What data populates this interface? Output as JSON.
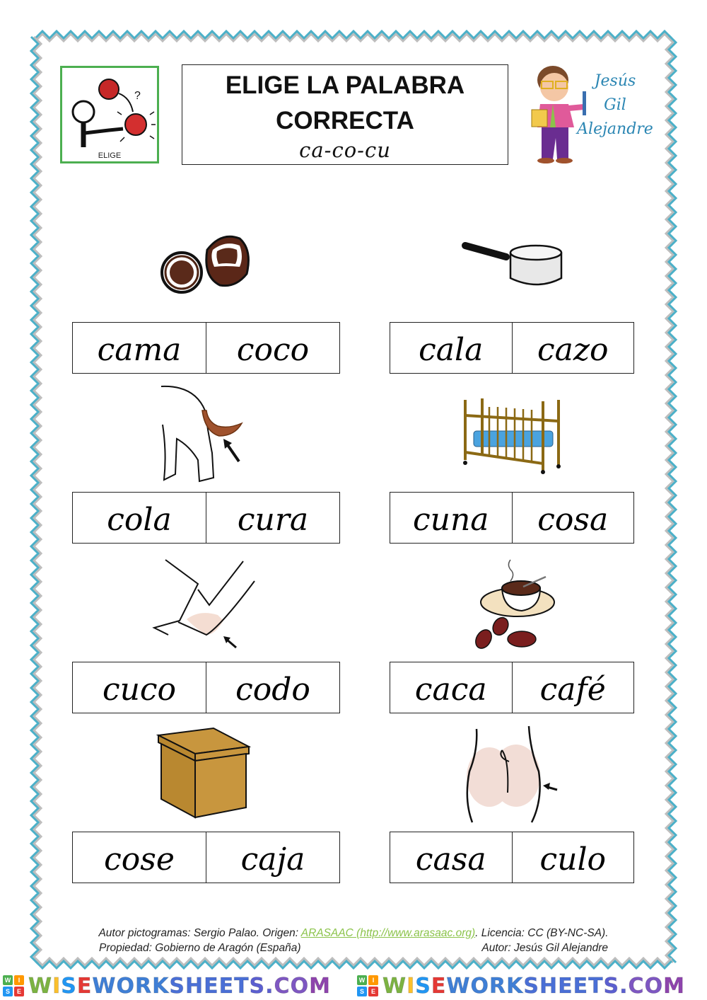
{
  "header": {
    "pictogram_label": "ELIGE",
    "title_line1": "ELIGE LA PALABRA",
    "title_line2": "CORRECTA",
    "syllables": "ca-co-cu",
    "author_first": "Jesús",
    "author_middle": "Gil",
    "author_last": "Alejandre"
  },
  "items": [
    {
      "picture": "coconut",
      "options": [
        "cama",
        "coco"
      ]
    },
    {
      "picture": "saucepan",
      "options": [
        "cala",
        "cazo"
      ]
    },
    {
      "picture": "dog-tail",
      "options": [
        "cola",
        "cura"
      ]
    },
    {
      "picture": "crib",
      "options": [
        "cuna",
        "cosa"
      ]
    },
    {
      "picture": "elbow",
      "options": [
        "cuco",
        "codo"
      ]
    },
    {
      "picture": "coffee",
      "options": [
        "caca",
        "café"
      ]
    },
    {
      "picture": "box",
      "options": [
        "cose",
        "caja"
      ]
    },
    {
      "picture": "buttocks",
      "options": [
        "casa",
        "culo"
      ]
    }
  ],
  "credits": {
    "line1_prefix": "Autor pictogramas: Sergio Palao. Origen: ",
    "link_text": "ARASAAC (http://www.arasaac.org)",
    "line1_suffix": ". Licencia: CC (BY-NC-SA).",
    "property": "Propiedad: Gobierno de Aragón (España)",
    "author": "Autor: Jesús Gil Alejandre"
  },
  "brand": {
    "tiles": [
      "W",
      "I",
      "S",
      "E"
    ],
    "text": "WISEWORKSHEETS.COM",
    "colors": {
      "border_blue": "#4bb0c8",
      "border_gray": "#bdbdbd",
      "pict_green": "#4caf50",
      "link_green": "#8bc34a"
    }
  }
}
